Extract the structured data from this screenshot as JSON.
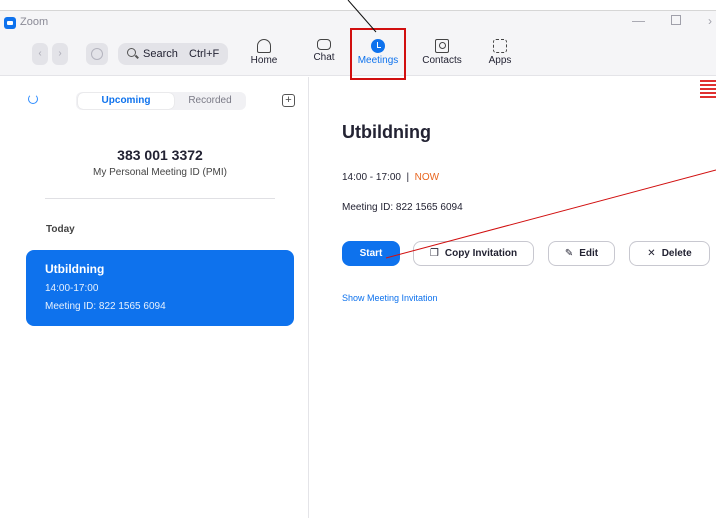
{
  "window": {
    "title": "Zoom"
  },
  "toolbar": {
    "search_label": "Search",
    "search_shortcut": "Ctrl+F",
    "tabs": [
      {
        "label": "Home",
        "icon": "home-icon",
        "active": false
      },
      {
        "label": "Chat",
        "icon": "chat-icon",
        "active": false
      },
      {
        "label": "Meetings",
        "icon": "meetings-icon",
        "active": true
      },
      {
        "label": "Contacts",
        "icon": "contacts-icon",
        "active": false
      },
      {
        "label": "Apps",
        "icon": "apps-icon",
        "active": false
      }
    ]
  },
  "sidebar": {
    "tabs": {
      "upcoming": "Upcoming",
      "recorded": "Recorded",
      "selected": "Upcoming"
    },
    "pmi": {
      "number": "383 001 3372",
      "label": "My Personal Meeting ID (PMI)"
    },
    "section_label": "Today",
    "meetings": [
      {
        "title": "Utbildning",
        "time": "14:00-17:00",
        "meeting_id": "Meeting ID: 822 1565 6094",
        "selected": true
      }
    ]
  },
  "detail": {
    "title": "Utbildning",
    "time": "14:00 - 17:00",
    "separator": "|",
    "status": "NOW",
    "meeting_id": "Meeting ID: 822 1565 6094",
    "buttons": {
      "start": "Start",
      "copy": "Copy Invitation",
      "edit": "Edit",
      "delete": "Delete"
    },
    "invitation_link": "Show Meeting Invitation"
  },
  "colors": {
    "accent": "#0e72ed",
    "now": "#e8651e",
    "annotation": "#d10f0f"
  }
}
